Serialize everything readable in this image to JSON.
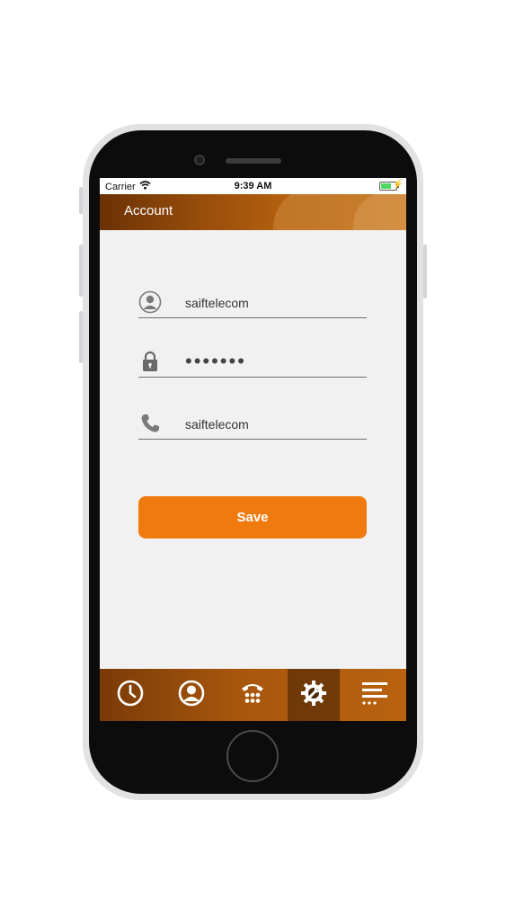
{
  "status_bar": {
    "carrier": "Carrier",
    "time": "9:39 AM"
  },
  "nav": {
    "title": "Account"
  },
  "form": {
    "username": "saiftelecom",
    "password_mask": "•••••••",
    "phone": "saiftelecom",
    "save_label": "Save"
  },
  "tabs": [
    {
      "icon": "clock-icon"
    },
    {
      "icon": "user-icon"
    },
    {
      "icon": "dialpad-icon"
    },
    {
      "icon": "settings-icon",
      "active": true
    },
    {
      "icon": "menu-icon"
    }
  ],
  "colors": {
    "accent": "#ef7a0e",
    "nav_dark": "#6b3205",
    "nav_light": "#c06c14",
    "screen_bg": "#f1f1f1"
  }
}
